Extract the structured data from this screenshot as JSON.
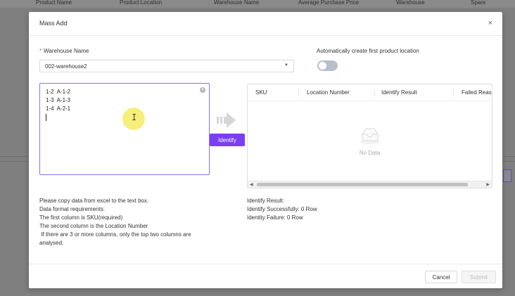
{
  "background": {
    "columns": [
      "Product Name",
      "Product Location",
      "Warehouse Name",
      "Average Purchase Price",
      "Warehouse",
      "Spare"
    ]
  },
  "modal": {
    "title": "Mass Add",
    "close_glyph": "×",
    "warehouse": {
      "required_mark": "*",
      "label": "Warehouse Name",
      "value": "002-warehouse2"
    },
    "auto_location": {
      "label": "Automatically create first product location",
      "enabled": false
    },
    "input": {
      "lines": [
        "1-2  A-1-2",
        "1-3  A-1-3",
        "1-4  A-2-1"
      ]
    },
    "identify_button": "Identify",
    "table": {
      "columns": [
        "SKU",
        "Location Number",
        "Identify Result",
        "Failed Reas"
      ],
      "empty_text": "No Data"
    },
    "instructions": [
      "Please copy data from excel to the text box.",
      "Data format requirements:",
      "The first column is SKU(required)",
      "The second column is the Location Number",
      " If there are 3 or more columns, only the top two columns are",
      "analysed."
    ],
    "result": {
      "heading": "Identify Result:",
      "success": "Identify Successfully: 0 Row",
      "failure": "Identity Failure: 0 Row"
    },
    "footer": {
      "cancel": "Cancel",
      "submit": "Submit"
    }
  },
  "colors": {
    "accent": "#7b3ff2",
    "required": "#e5484d",
    "toggle_off": "#b8bfcc"
  }
}
